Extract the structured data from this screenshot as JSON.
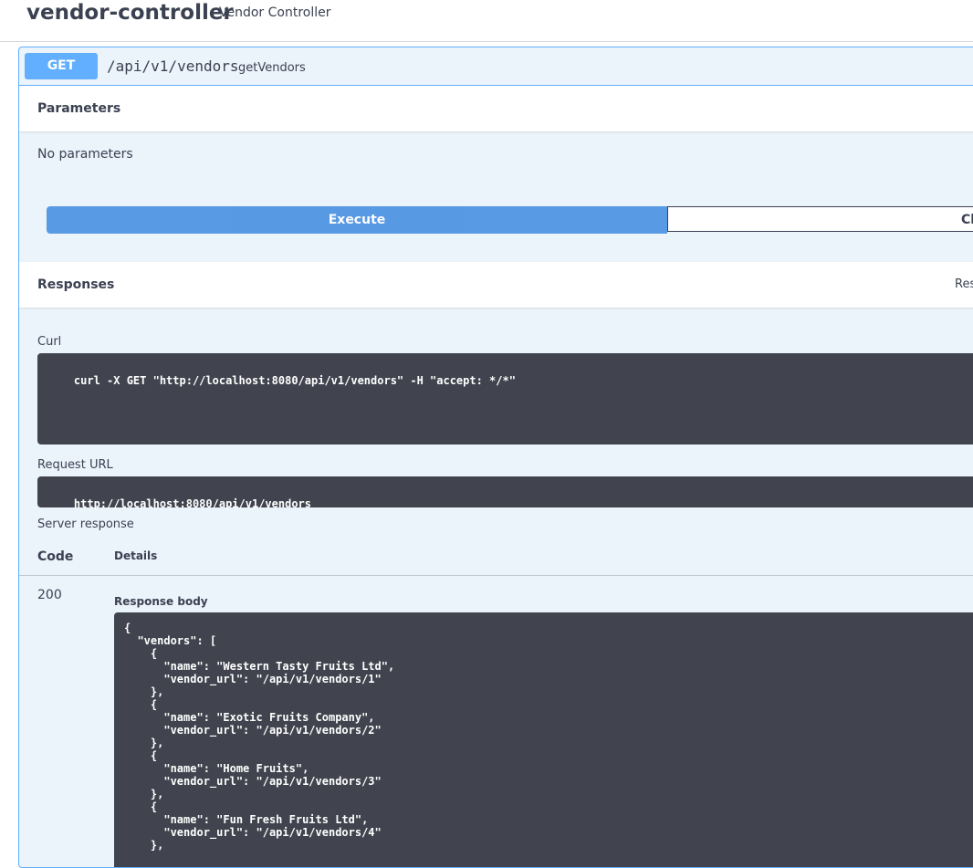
{
  "tag": {
    "name": "vendor-controller",
    "description": "Vendor Controller"
  },
  "operation": {
    "method": "GET",
    "path": "/api/v1/vendors",
    "operation_id": "getVendors"
  },
  "parameters": {
    "heading": "Parameters",
    "empty_text": "No parameters"
  },
  "buttons": {
    "execute": "Execute",
    "clear": "Cl"
  },
  "responses": {
    "heading": "Responses",
    "right_label": "Res",
    "curl_label": "Curl",
    "curl_command": "curl -X GET \"http://localhost:8080/api/v1/vendors\" -H \"accept: */*\"",
    "request_url_label": "Request URL",
    "request_url": "http://localhost:8080/api/v1/vendors",
    "server_response_label": "Server response",
    "col_code": "Code",
    "col_details": "Details",
    "status_code": "200",
    "response_body_label": "Response body",
    "response_body_lines": [
      "{",
      "  \"vendors\": [",
      "    {",
      "      \"name\": \"Western Tasty Fruits Ltd\",",
      "      \"vendor_url\": \"/api/v1/vendors/1\"",
      "    },",
      "    {",
      "      \"name\": \"Exotic Fruits Company\",",
      "      \"vendor_url\": \"/api/v1/vendors/2\"",
      "    },",
      "    {",
      "      \"name\": \"Home Fruits\",",
      "      \"vendor_url\": \"/api/v1/vendors/3\"",
      "    },",
      "    {",
      "      \"name\": \"Fun Fresh Fruits Ltd\",",
      "      \"vendor_url\": \"/api/v1/vendors/4\"",
      "    },"
    ]
  },
  "colors": {
    "get_method": "#61affe",
    "block_bg": "#ebf3fb",
    "execute": "#4990e2",
    "code_bg": "#41444e"
  }
}
